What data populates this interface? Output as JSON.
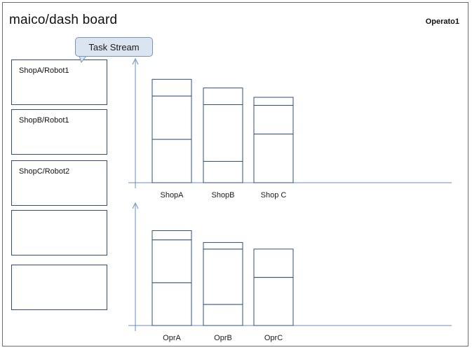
{
  "app": {
    "title": "maico/dash  board",
    "operator": "Operato1"
  },
  "tooltip": {
    "label": "Task Stream"
  },
  "sidebar": {
    "cards": [
      {
        "label": "ShopA/Robot1"
      },
      {
        "label": "ShopB/Robot1"
      },
      {
        "label": "ShopC/Robot2"
      },
      {
        "label": ""
      },
      {
        "label": ""
      }
    ]
  },
  "colors": {
    "line": "#2f4f7a",
    "axis": "#6a8fc0",
    "tooltip_bg": "#dbe5f2"
  },
  "chart_data": [
    {
      "type": "bar",
      "stacked": true,
      "categories": [
        "ShopA",
        "ShopB",
        "Shop C"
      ],
      "ylim": [
        0,
        170
      ],
      "segments": [
        [
          65,
          65,
          25
        ],
        [
          32,
          85,
          25
        ],
        [
          73,
          43,
          12
        ]
      ],
      "axis": "y-axis with up arrow, baseline line"
    },
    {
      "type": "bar",
      "stacked": true,
      "categories": [
        "OprA",
        "OprB",
        "OprC"
      ],
      "ylim": [
        0,
        170
      ],
      "segments": [
        [
          65,
          65,
          14
        ],
        [
          32,
          84,
          10
        ],
        [
          73,
          43
        ]
      ],
      "axis": "y-axis with up arrow, baseline line"
    }
  ]
}
